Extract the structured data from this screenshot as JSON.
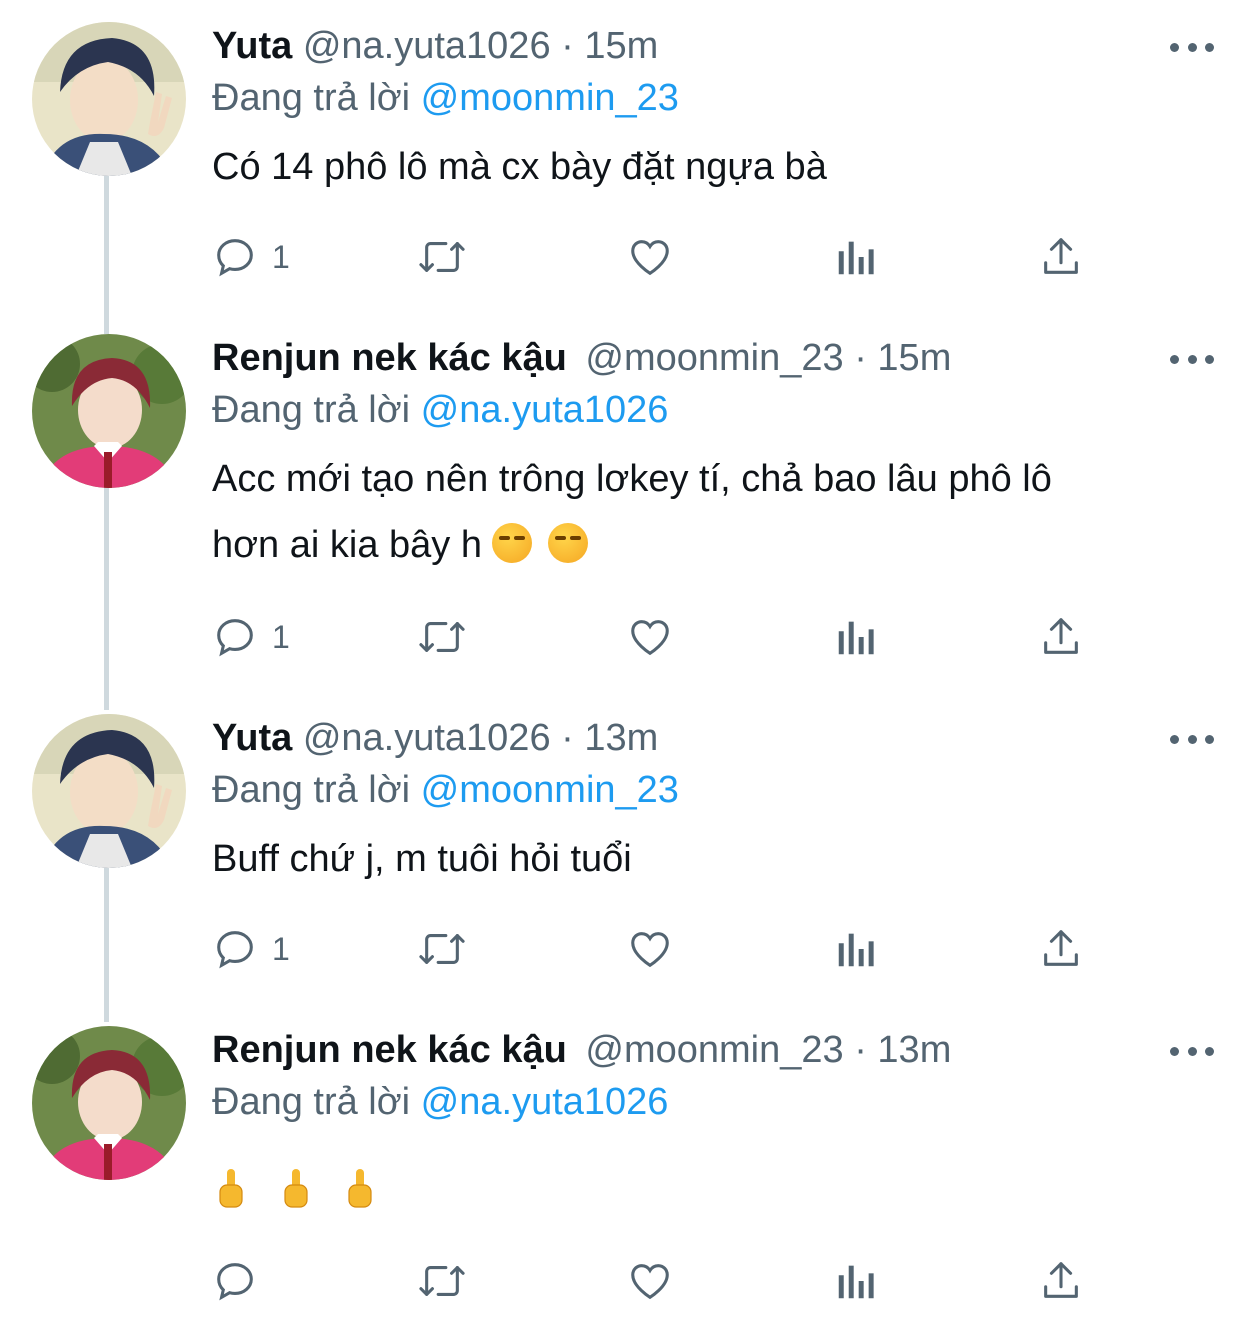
{
  "tweets": [
    {
      "name": "Yuta",
      "handle": "@na.yuta1026",
      "separator": "·",
      "time": "15m",
      "replying_prefix": "Đang trả lời",
      "replying_to": "@moonmin_23",
      "text": "Có 14 phô lô mà cx bày đặt ngựa bà",
      "reply_count": "1",
      "avatar_icon": "avatar-yuta"
    },
    {
      "name": "Renjun nek kác kậu",
      "handle": "@moonmin_23",
      "separator": "·",
      "time": "15m",
      "replying_prefix": "Đang trả lời",
      "replying_to": "@na.yuta1026",
      "text_line1": "Acc mới tạo nên trông lơkey tí, chả bao lâu phô lô",
      "text_line2": "hơn ai kia bây h",
      "emoji": "smirking-face-emoji x2",
      "reply_count": "1",
      "avatar_icon": "avatar-renjun"
    },
    {
      "name": "Yuta",
      "handle": "@na.yuta1026",
      "separator": "·",
      "time": "13m",
      "replying_prefix": "Đang trả lời",
      "replying_to": "@moonmin_23",
      "text": "Buff chứ j, m tuôi hỏi tuổi",
      "reply_count": "1",
      "avatar_icon": "avatar-yuta"
    },
    {
      "name": "Renjun nek kác kậu",
      "handle": "@moonmin_23",
      "separator": "·",
      "time": "13m",
      "replying_prefix": "Đang trả lời",
      "replying_to": "@na.yuta1026",
      "emoji": "middle-finger-emoji x3",
      "reply_count": "",
      "avatar_icon": "avatar-renjun"
    }
  ],
  "colors": {
    "text": "#0f1419",
    "secondary": "#536471",
    "mention": "#1d9bf0",
    "thread_line": "#cfd9de"
  }
}
